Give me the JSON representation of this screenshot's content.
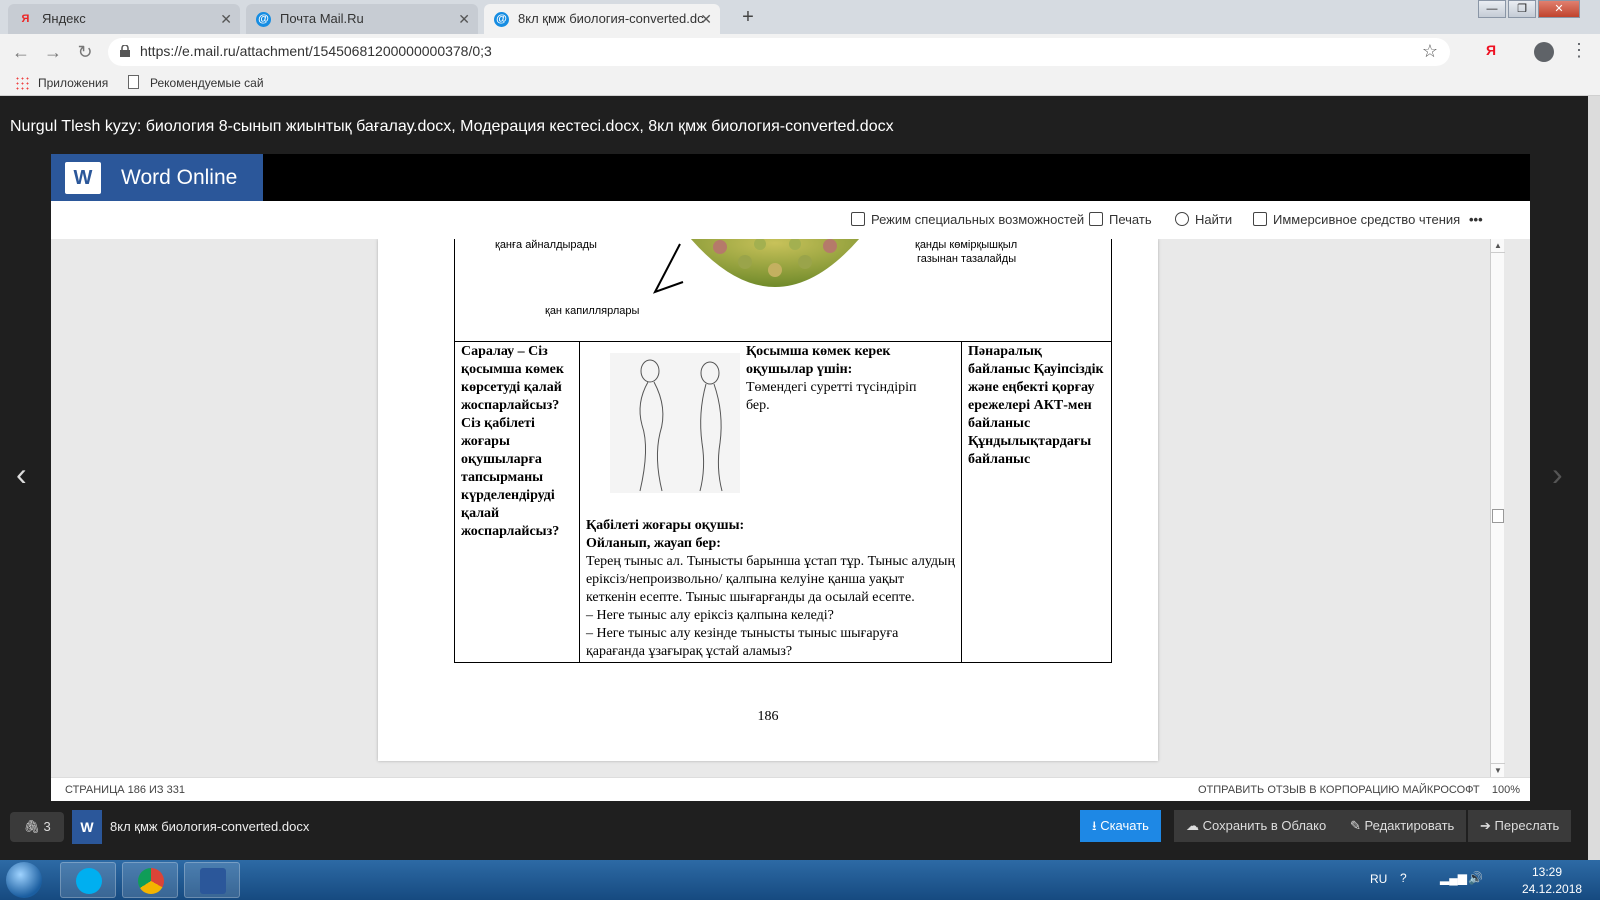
{
  "browser": {
    "tabs": [
      {
        "label": "Яндекс",
        "favicon": "yandex-icon"
      },
      {
        "label": "Почта Mail.Ru",
        "favicon": "mailru-icon"
      },
      {
        "label": "8кл қмж биология-converted.dc",
        "favicon": "mailru-icon"
      }
    ],
    "url": "https://e.mail.ru/attachment/15450681200000000378/0;3",
    "extension_label": "Я",
    "bookmarks": [
      "Приложения",
      "Рекомендуемые сай"
    ]
  },
  "viewer": {
    "title": "Nurgul Tlesh kyzy: биология 8-сынып жиынтық бағалау.docx, Модерация кестесі.docx, 8кл қмж биология-converted.docx",
    "app_name": "Word Online",
    "commands": {
      "accessibility": "Режим специальных возможностей",
      "print": "Печать",
      "find": "Найти",
      "immersive": "Иммерсивное средство чтения",
      "more": "•••"
    },
    "status_page": "СТРАНИЦА 186 ИЗ 331",
    "status_feedback": "ОТПРАВИТЬ ОТЗЫВ В КОРПОРАЦИЮ МАЙКРОСОФТ",
    "zoom": "100%",
    "attachments_count": "3",
    "attachment_name": "8кл қмж биология-converted.docx",
    "actions": {
      "download": "Скачать",
      "save_cloud": "Сохранить в Облако",
      "edit": "Редактировать",
      "forward": "Переслать"
    }
  },
  "document": {
    "figure_labels": {
      "left": "қанға айналдырады",
      "right_line1": "қанды көмірқышқыл",
      "right_line2": "газынан тазалайды",
      "bottom": "қан капиллярлары"
    },
    "col1": "Саралау – Сіз қосымша көмек көрсетуді қалай жоспарлайсыз? Сіз қабілеті жоғары оқушыларға тапсырманы күрделендіруді қалай жоспарлайсыз?",
    "col2": {
      "help_heading": "Қосымша көмек керек оқушылар үшін:",
      "help_text": "Төмендегі суретті түсіндіріп бер.",
      "gifted_heading": "Қабілеті жоғары оқушы:",
      "gifted_sub": "Ойланып, жауап бер:",
      "task": "Терең тыныс ал. Тынысты барынша ұстап тұр. Тыныс алудың еріксіз/непроизвольно/ қалпына келуіне қанша уақыт кеткенін есепте. Тыныс шығарғанды да осылай есепте.",
      "q1": "– Неге тыныс алу еріксіз қалпына келеді?",
      "q2": "– Неге тыныс алу кезінде тынысты тыныс шығаруға қарағанда ұзағырақ ұстай аламыз?"
    },
    "col3": "Пәнаралық байланыс Қауіпсіздік және еңбекті қорғау ережелері АКТ-мен байланыс Құндылықтардағы байланыс",
    "page_number": "186"
  },
  "taskbar": {
    "lang": "RU",
    "time": "13:29",
    "date": "24.12.2018"
  }
}
